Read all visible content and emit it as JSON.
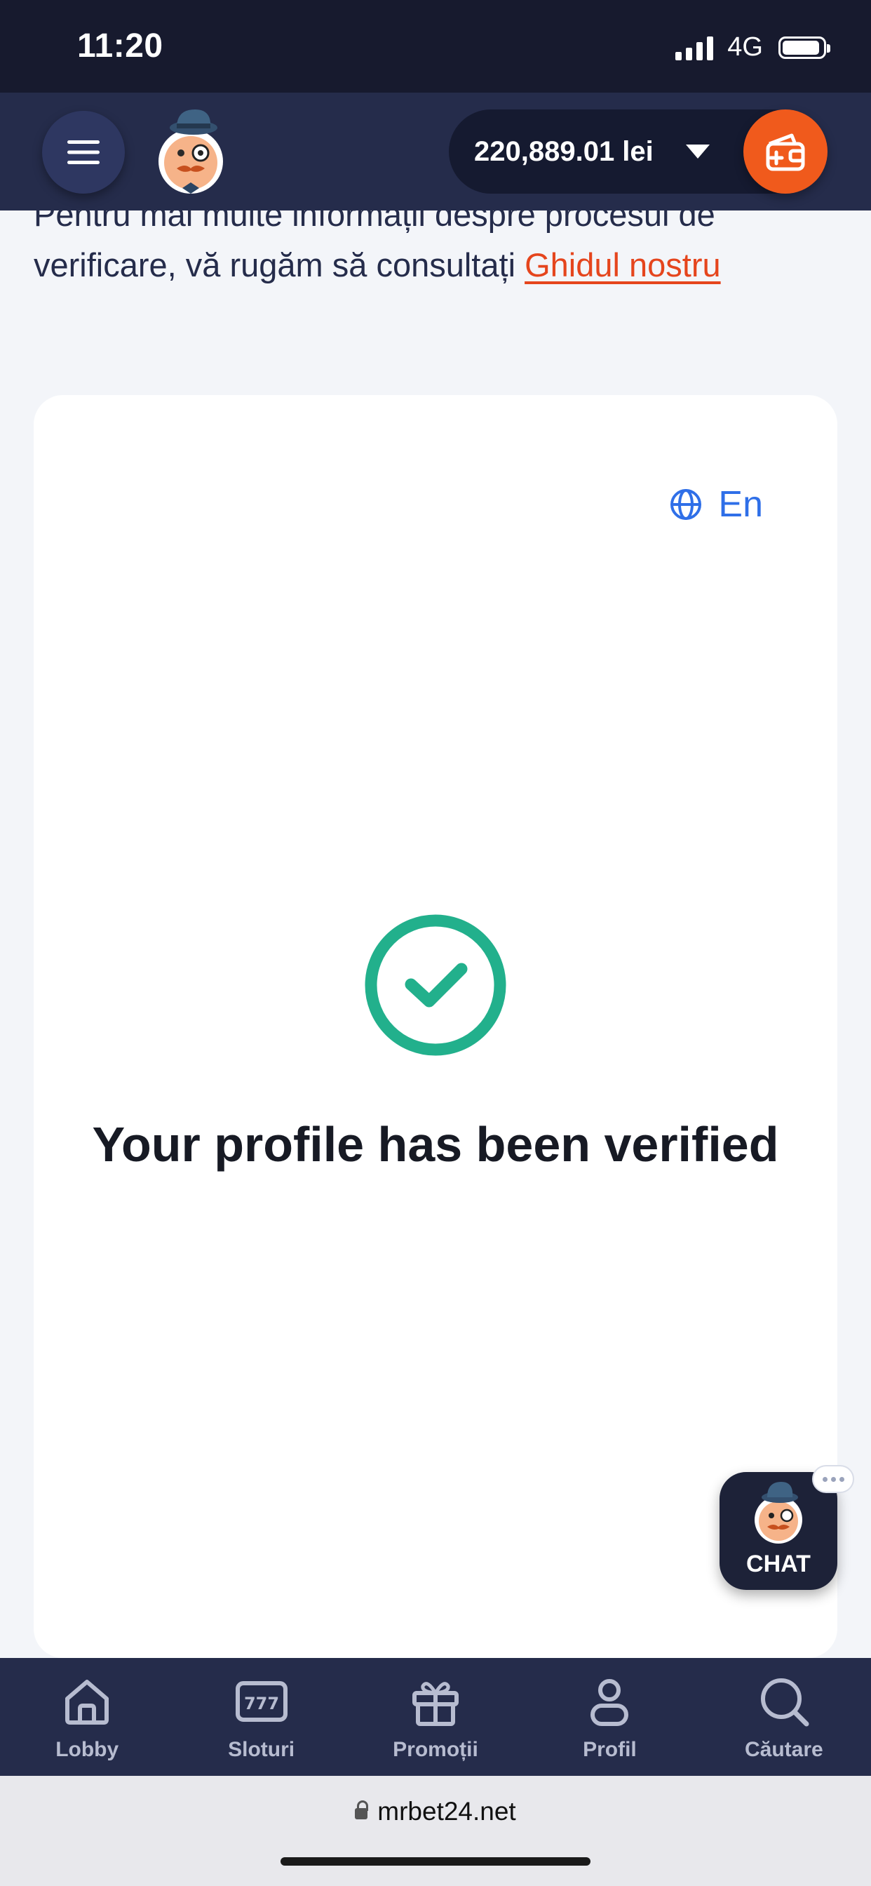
{
  "status_bar": {
    "time": "11:20",
    "network": "4G",
    "icons": [
      "signal-icon",
      "battery-icon"
    ]
  },
  "header": {
    "menu_icon": "hamburger-icon",
    "logo_icon": "mascot-logo",
    "balance": "220,889.01 lei",
    "dropdown_icon": "caret-down-icon",
    "wallet_icon": "wallet-plus-icon"
  },
  "intro": {
    "text_line1": "Pentru mai multe informații despre procesul de",
    "text_line2": "verificare, vă rugăm să consultați ",
    "link": "Ghidul nostru"
  },
  "card": {
    "language_icon": "globe-icon",
    "language": "En",
    "status_icon": "check-circle-icon",
    "title": "Your profile has been verified"
  },
  "chat": {
    "label": "CHAT"
  },
  "bottom_nav": {
    "items": [
      {
        "label": "Lobby",
        "icon": "home-icon"
      },
      {
        "label": "Sloturi",
        "icon": "slots-777-icon"
      },
      {
        "label": "Promoții",
        "icon": "gift-icon"
      },
      {
        "label": "Profil",
        "icon": "user-icon"
      },
      {
        "label": "Căutare",
        "icon": "search-icon"
      }
    ]
  },
  "browser": {
    "url": "mrbet24.net"
  },
  "colors": {
    "header_bg": "#252c4b",
    "status_bg": "#171a2e",
    "accent_orange": "#f05a1c",
    "link_orange": "#e5451d",
    "success_green": "#22b08c",
    "language_blue": "#2f6fe8"
  }
}
